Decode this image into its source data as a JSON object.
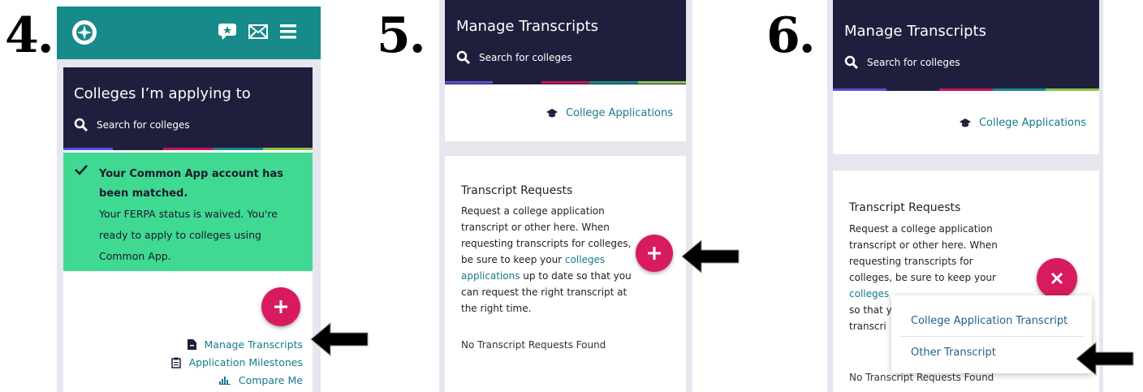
{
  "steps": [
    "4.",
    "5.",
    "6."
  ],
  "colors": {
    "teal": "#178a8a",
    "navy": "#1f1f3d",
    "green": "#40d992",
    "pink": "#d81b60",
    "link": "#157a8c",
    "stripe": [
      "#5b4fd6",
      "#1f1f3d",
      "#c2185b",
      "#178a8a",
      "#8bc34a"
    ]
  },
  "screen4": {
    "topbar": {
      "icons": [
        "compass-logo-icon",
        "chat-icon",
        "mail-icon",
        "hamburger-menu-icon"
      ]
    },
    "title": "Colleges I’m applying to",
    "search_label": "Search for colleges",
    "notice_bold": "Your Common App account has been matched.",
    "notice_text": "Your FERPA status is waived. You're ready to apply to colleges using Common App.",
    "links": [
      "Manage Transcripts",
      "Application Milestones",
      "Compare Me"
    ]
  },
  "screen5": {
    "title": "Manage Transcripts",
    "search_label": "Search for colleges",
    "college_link": "College Applications",
    "req_title": "Transcript Requests",
    "req_text_before": "Request a college application transcript or other here. When requesting transcripts for colleges, be sure to keep your ",
    "req_link": "colleges applications",
    "req_text_after": " up to date so that you can request the right transcript at the right time.",
    "none_found": "No Transcript Requests Found"
  },
  "screen6": {
    "title": "Manage Transcripts",
    "search_label": "Search for colleges",
    "college_link": "College Applications",
    "req_title": "Transcript Requests",
    "req_line1": "Request a college application",
    "req_line2": "transcript or other here. When",
    "req_line3": "requesting transcripts for",
    "req_line4": "colleges, be sure to keep your",
    "req_line5": "colleges",
    "req_line6": "so that y",
    "req_line7": "transcri",
    "none_found": "No Transcript Requests Found",
    "menu": [
      "College Application Transcript",
      "Other Transcript"
    ]
  }
}
